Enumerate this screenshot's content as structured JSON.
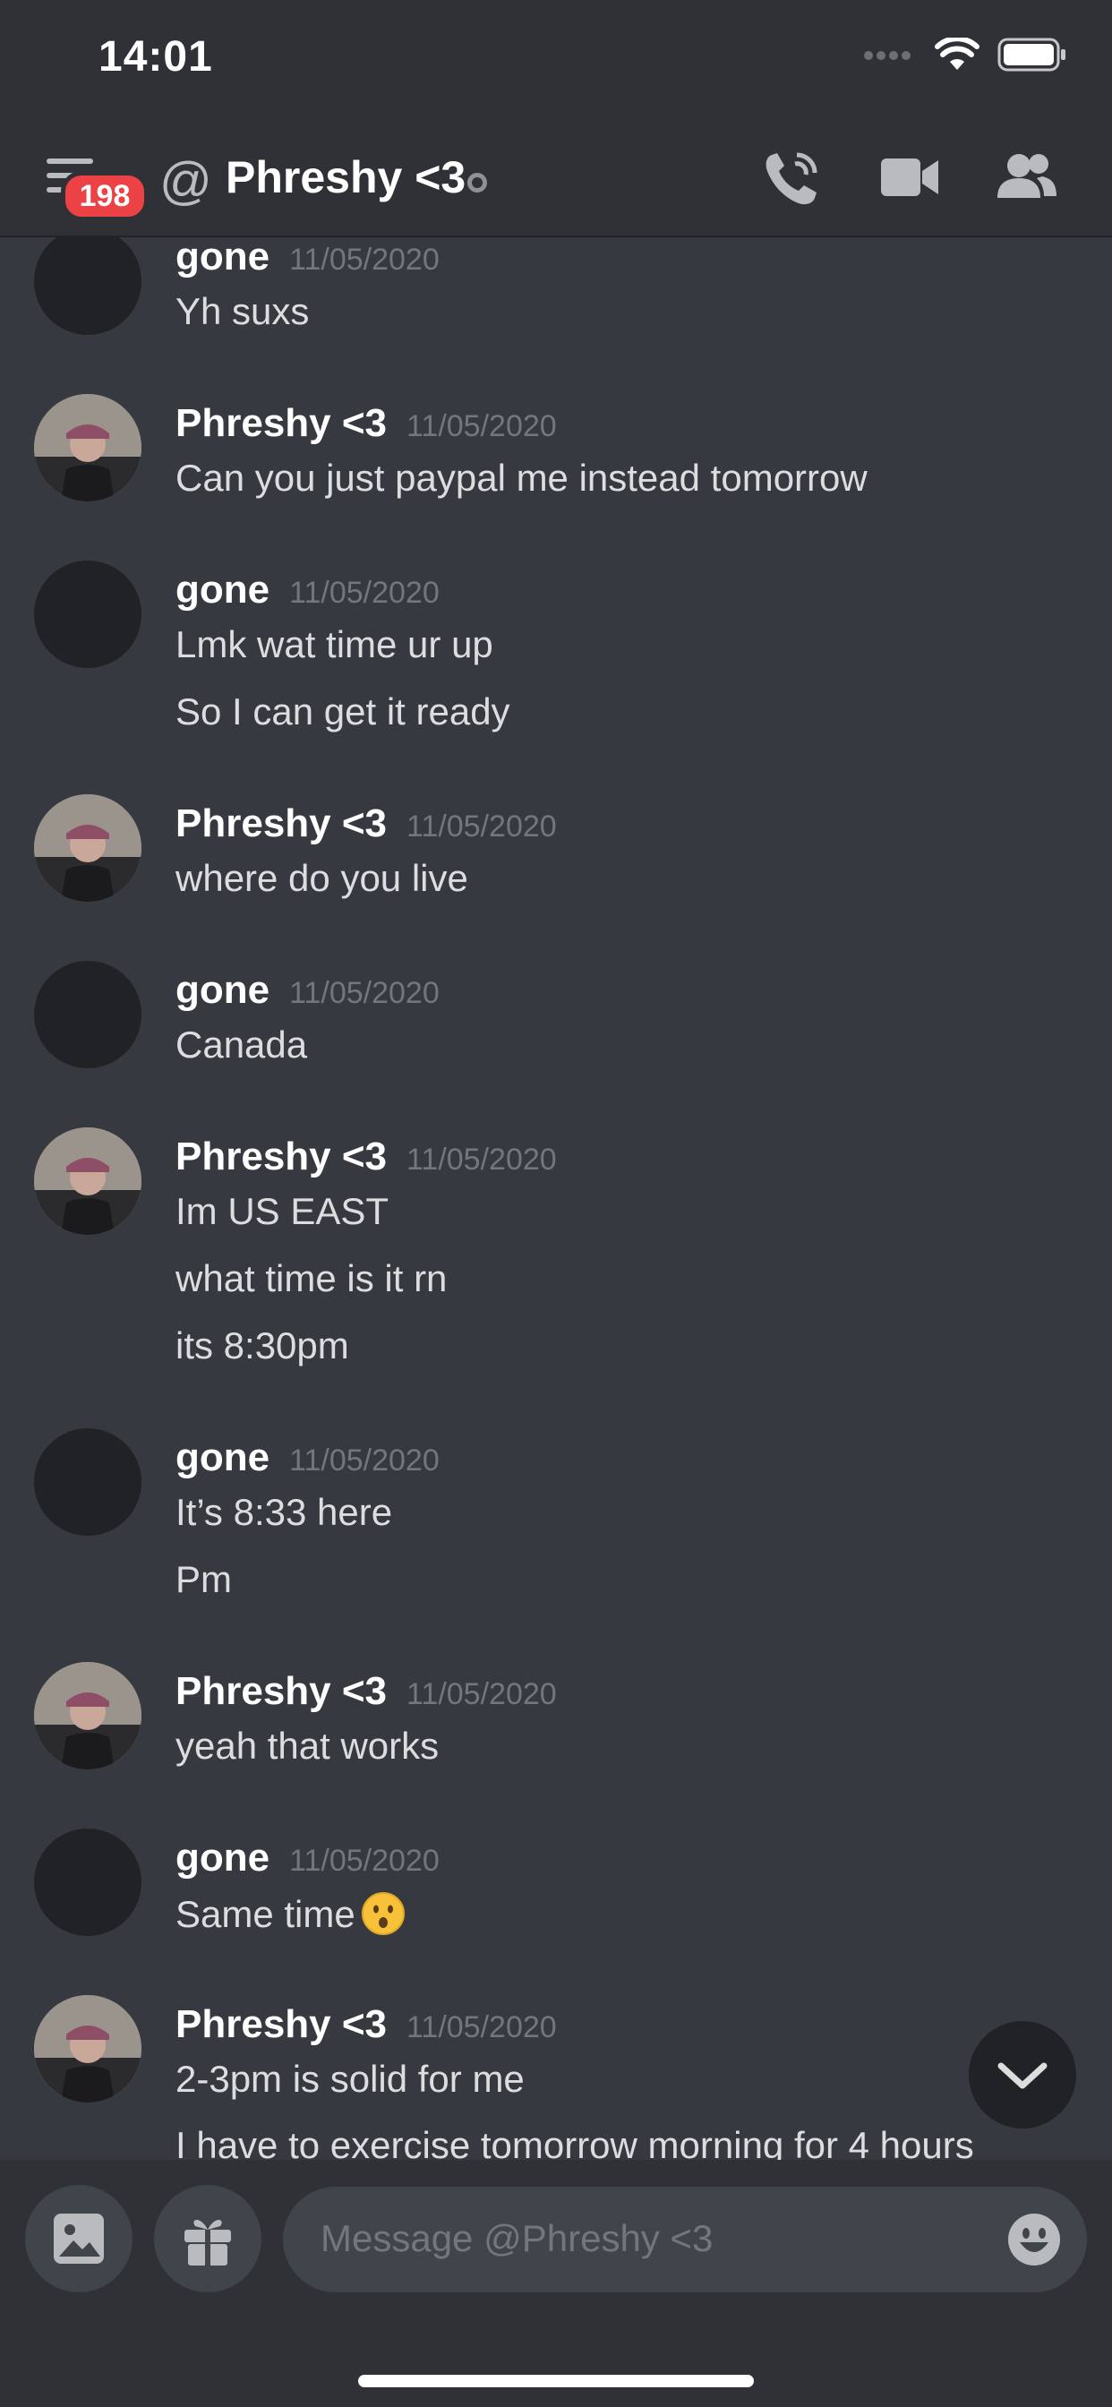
{
  "status_bar": {
    "time": "14:01"
  },
  "header": {
    "badge_count": "198",
    "title": "Phreshy <3"
  },
  "messages": [
    {
      "author": "gone",
      "timestamp": "11/05/2020",
      "avatar": "dark",
      "lines": [
        "Yh suxs"
      ]
    },
    {
      "author": "Phreshy <3",
      "timestamp": "11/05/2020",
      "avatar": "photo",
      "lines": [
        "Can you just paypal me instead tomorrow"
      ]
    },
    {
      "author": "gone",
      "timestamp": "11/05/2020",
      "avatar": "dark",
      "lines": [
        "Lmk wat time ur up",
        "So I can get it ready"
      ]
    },
    {
      "author": "Phreshy <3",
      "timestamp": "11/05/2020",
      "avatar": "photo",
      "lines": [
        "where do you live"
      ]
    },
    {
      "author": "gone",
      "timestamp": "11/05/2020",
      "avatar": "dark",
      "lines": [
        "Canada"
      ]
    },
    {
      "author": "Phreshy <3",
      "timestamp": "11/05/2020",
      "avatar": "photo",
      "lines": [
        "Im US EAST",
        "what time is it rn",
        "its 8:30pm"
      ]
    },
    {
      "author": "gone",
      "timestamp": "11/05/2020",
      "avatar": "dark",
      "lines": [
        "It’s 8:33 here",
        "Pm"
      ]
    },
    {
      "author": "Phreshy <3",
      "timestamp": "11/05/2020",
      "avatar": "photo",
      "lines": [
        "yeah that works"
      ]
    },
    {
      "author": "gone",
      "timestamp": "11/05/2020",
      "avatar": "dark",
      "lines": [
        "Same time"
      ],
      "emoji": "hushed-face-emoji"
    },
    {
      "author": "Phreshy <3",
      "timestamp": "11/05/2020",
      "avatar": "photo",
      "lines": [
        "2-3pm is solid for me",
        "I have to exercise tomorrow morning for 4 hours"
      ]
    }
  ],
  "composer": {
    "placeholder": "Message @Phreshy <3"
  },
  "colors": {
    "background": "#36393f",
    "header": "#2f3136",
    "badge": "#ed4245",
    "input": "#40444b"
  }
}
